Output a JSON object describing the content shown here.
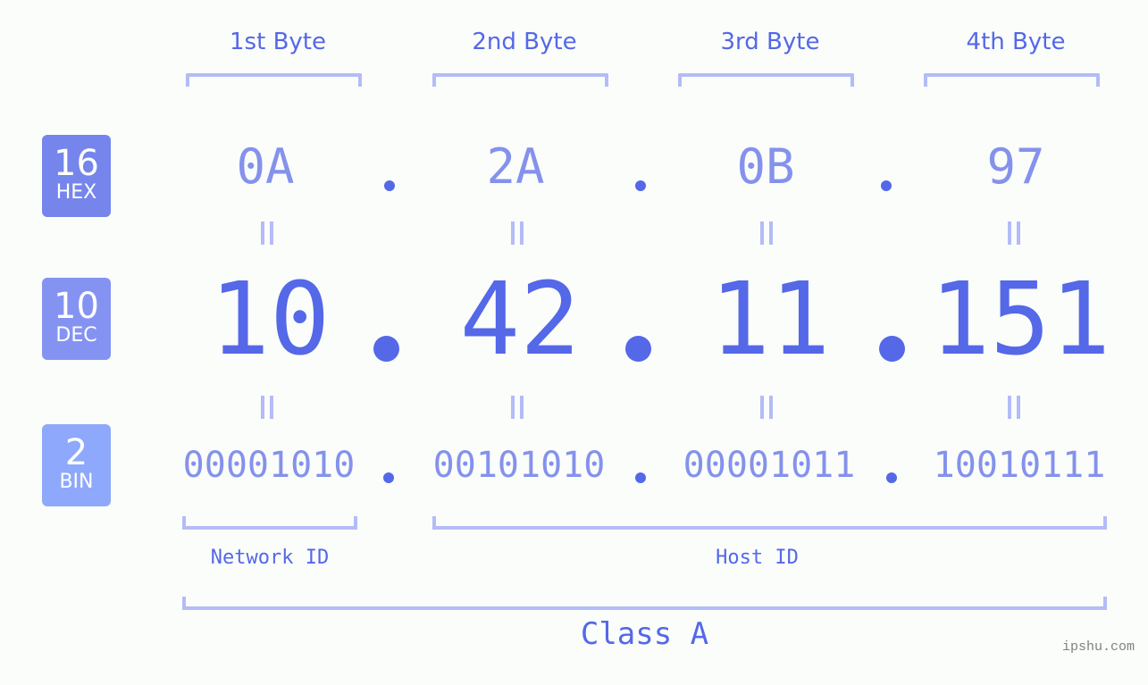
{
  "bytes": [
    {
      "label": "1st Byte",
      "hex": "0A",
      "dec": "10",
      "bin": "00001010"
    },
    {
      "label": "2nd Byte",
      "hex": "2A",
      "dec": "42",
      "bin": "00101010"
    },
    {
      "label": "3rd Byte",
      "hex": "0B",
      "dec": "11",
      "bin": "00001011"
    },
    {
      "label": "4th Byte",
      "hex": "97",
      "dec": "151",
      "bin": "10010111"
    }
  ],
  "bases": {
    "hex": {
      "number": "16",
      "name": "HEX",
      "color": "#7585ec"
    },
    "dec": {
      "number": "10",
      "name": "DEC",
      "color": "#8493f2"
    },
    "bin": {
      "number": "2",
      "name": "BIN",
      "color": "#8ea8fb"
    }
  },
  "ip_address": "10.42.11.151",
  "segments": {
    "network_id": "Network ID",
    "host_id": "Host ID"
  },
  "class_label": "Class A",
  "watermark": "ipshu.com",
  "colors": {
    "primary": "#5468e8",
    "secondary": "#8492ec",
    "bracket": "#b3bcf6",
    "background": "#fbfdfb"
  }
}
